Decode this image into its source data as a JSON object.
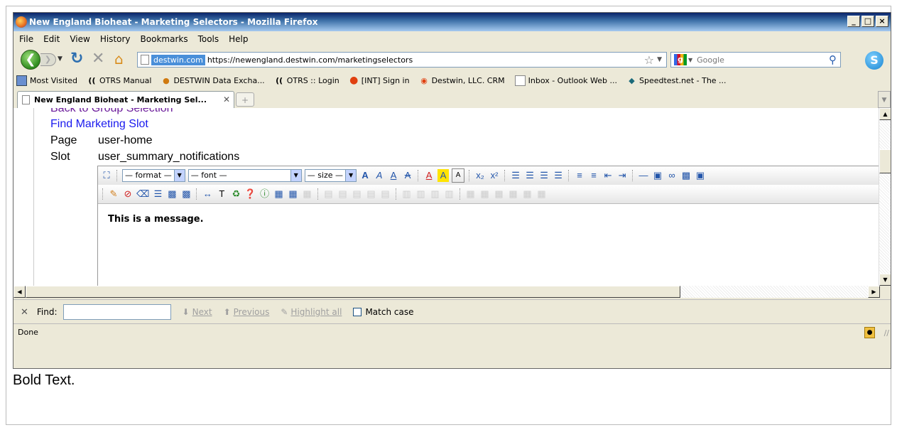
{
  "window": {
    "title": "New England Bioheat - Marketing Selectors - Mozilla Firefox",
    "controls": [
      "_",
      "□",
      "×"
    ]
  },
  "menu": [
    "File",
    "Edit",
    "View",
    "History",
    "Bookmarks",
    "Tools",
    "Help"
  ],
  "nav": {
    "url_site": "destwin.com",
    "url": "https://newengland.destwin.com/marketingselectors",
    "search_placeholder": "Google",
    "search_engine_letter": "g"
  },
  "bookmarks": [
    {
      "icon": "folder-icon",
      "label": "Most Visited"
    },
    {
      "icon": "otrs-icon",
      "label": "OTRS Manual"
    },
    {
      "icon": "destwin-icon",
      "label": "DESTWIN Data Excha..."
    },
    {
      "icon": "otrs-icon",
      "label": "OTRS :: Login"
    },
    {
      "icon": "ball-icon",
      "label": "[INT] Sign in"
    },
    {
      "icon": "crm-icon",
      "label": "Destwin, LLC. CRM"
    },
    {
      "icon": "page-icon",
      "label": "Inbox - Outlook Web ..."
    },
    {
      "icon": "speedtest-icon",
      "label": "Speedtest.net - The ..."
    }
  ],
  "tab": {
    "title": "New England Bioheat - Marketing Sel...",
    "new_tab_symbol": "+"
  },
  "content": {
    "link_back": "Back to Group Selection",
    "link_find": "Find Marketing Slot",
    "page_label": "Page",
    "page_value": "user-home",
    "slot_label": "Slot",
    "slot_value": "user_summary_notifications"
  },
  "editor": {
    "format_select": "— format —",
    "font_select": "— font —",
    "size_select": "— size —",
    "body_text": "This is a message."
  },
  "findbar": {
    "label": "Find:",
    "next": "Next",
    "previous": "Previous",
    "highlight": "Highlight all",
    "match_case": "Match case"
  },
  "status": {
    "text": "Done"
  },
  "below_text": "Bold Text."
}
